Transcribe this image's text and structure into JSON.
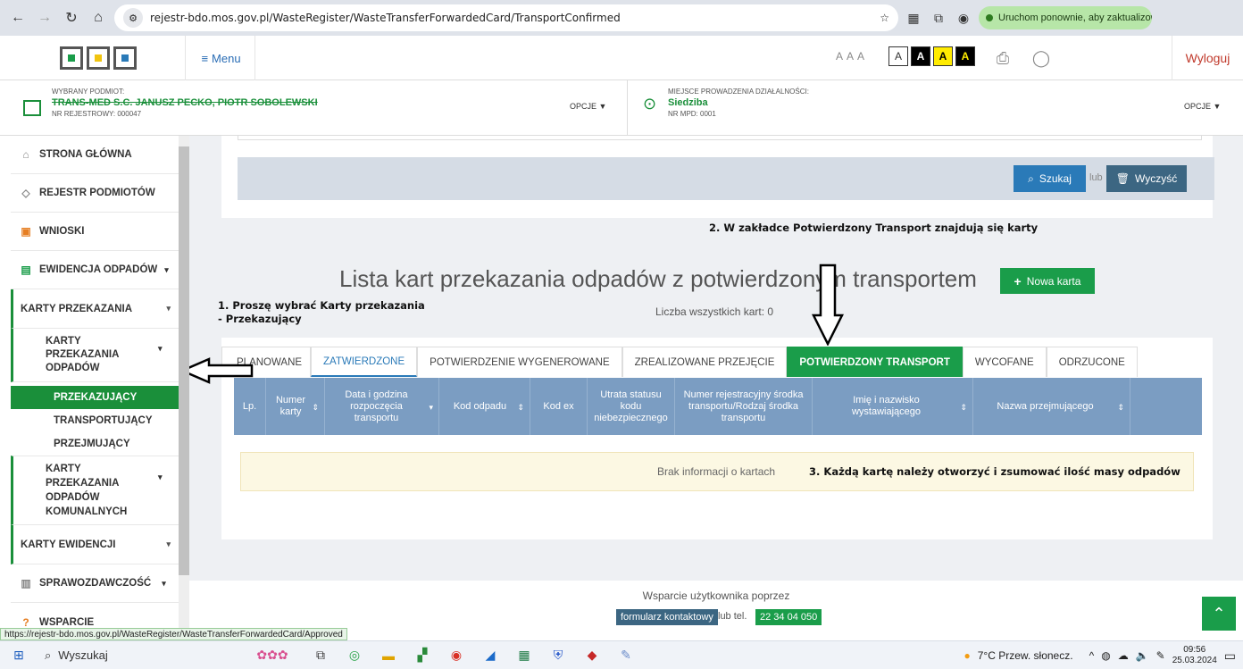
{
  "browser": {
    "url": "rejestr-bdo.mos.gov.pl/WasteRegister/WasteTransferForwardedCard/TransportConfirmed",
    "update_label": "Uruchom ponownie, aby zaktualizować"
  },
  "header": {
    "menu_label": "Menu",
    "font_sizes": "A A A",
    "contrast_options": [
      "A",
      "A",
      "A",
      "A"
    ],
    "logout_label": "Wyloguj"
  },
  "entity": {
    "left_caption": "WYBRANY PODMIOT:",
    "left_name": "TRANS-MED S.C. JANUSZ PECKO, PIOTR SOBOLEWSKI",
    "left_reg": "NR REJESTROWY: 000047",
    "left_opcje": "OPCJE",
    "right_caption": "MIEJSCE PROWADZENIA DZIAŁALNOŚCI:",
    "right_name": "Siedziba",
    "right_reg": "NR MPD: 0001",
    "right_opcje": "OPCJE"
  },
  "sidebar": {
    "items": [
      {
        "label": "STRONA GŁÓWNA"
      },
      {
        "label": "REJESTR PODMIOTÓW"
      },
      {
        "label": "WNIOSKI"
      },
      {
        "label": "EWIDENCJA ODPADÓW"
      }
    ],
    "karty_przekazania": "KARTY PRZEKAZANIA",
    "karty_przekazania_odpadow": "KARTY PRZEKAZANIA ODPADÓW",
    "sub": [
      "PRZEKAZUJĄCY",
      "TRANSPORTUJĄCY",
      "PRZEJMUJĄCY"
    ],
    "karty_komunalnych": "KARTY PRZEKAZANIA ODPADÓW KOMUNALNYCH",
    "karty_ewidencji": "KARTY EWIDENCJI",
    "sprawozdawczosc": "SPRAWOZDAWCZOŚĆ",
    "wsparcie": "WSPARCIE"
  },
  "main": {
    "search_label": "Szukaj",
    "lub": "lub",
    "clear_label": "Wyczyść",
    "annotation_2": "2. W zakładce Potwierdzony Transport znajdują się karty",
    "title": "Lista kart przekazania odpadów z potwierdzonym transportem",
    "new_card_label": "Nowa karta",
    "annotation_1": "1. Proszę wybrać Karty przekazania - Przekazujący",
    "count": "Liczba wszystkich kart: 0",
    "tabs": [
      "PLANOWANE",
      "ZATWIERDZONE",
      "POTWIERDZENIE WYGENEROWANE",
      "ZREALIZOWANE PRZEJĘCIE",
      "POTWIERDZONY TRANSPORT",
      "WYCOFANE",
      "ODRZUCONE"
    ],
    "columns": [
      "Lp.",
      "Numer karty",
      "Data i godzina rozpoczęcia transportu",
      "Kod odpadu",
      "Kod ex",
      "Utrata statusu kodu niebezpiecznego",
      "Numer rejestracyjny środka transportu/Rodzaj środka transportu",
      "Imię i nazwisko wystawiającego",
      "Nazwa przejmującego"
    ],
    "empty_text": "Brak informacji o kartach",
    "annotation_3": "3. Każdą kartę należy otworzyć i zsumować ilość masy odpadów"
  },
  "footer": {
    "support": "Wsparcie użytkownika poprzez",
    "form_label": "formularz kontaktowy",
    "tel_label": "lub tel.",
    "phone": "22 34 04 050"
  },
  "status_url": "https://rejestr-bdo.mos.gov.pl/WasteRegister/WasteTransferForwardedCard/Approved",
  "taskbar": {
    "search": "Wyszukaj",
    "weather": "7°C  Przew. słonecz.",
    "time": "09:56",
    "date": "25.03.2024"
  },
  "colors": {
    "brand_green": "#1a9d4a",
    "table_header": "#7b9dc2",
    "primary_blue": "#2a7ab8"
  }
}
